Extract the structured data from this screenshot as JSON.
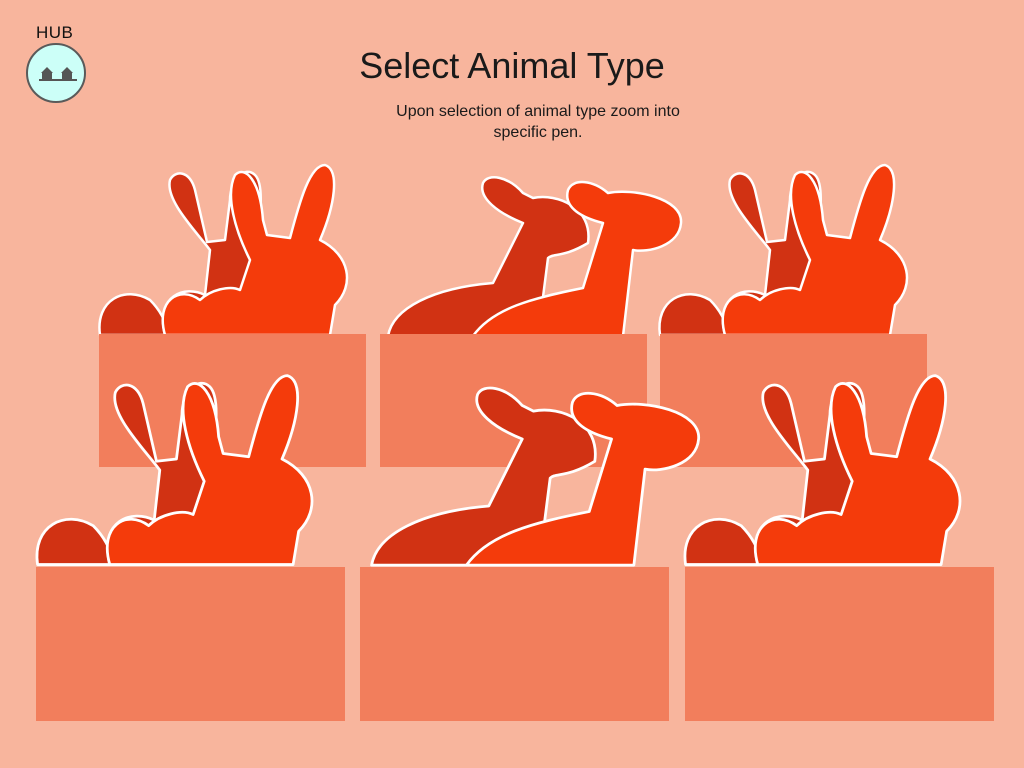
{
  "hub": {
    "label": "HUB",
    "icon": "barn-icon"
  },
  "header": {
    "title": "Select Animal Type",
    "subtitle": "Upon selection of animal type zoom into specific pen."
  },
  "colors": {
    "background": "#f8b59d",
    "pen": "#f27e5c",
    "animal_dark": "#d13213",
    "animal_light": "#f43b0b",
    "hub_fill": "#ccfff8"
  },
  "pens": [
    {
      "animal": "rabbit-icon"
    },
    {
      "animal": "giraffe-icon"
    },
    {
      "animal": "rabbit-icon"
    },
    {
      "animal": "rabbit-icon"
    },
    {
      "animal": "giraffe-icon"
    },
    {
      "animal": "rabbit-icon"
    }
  ]
}
